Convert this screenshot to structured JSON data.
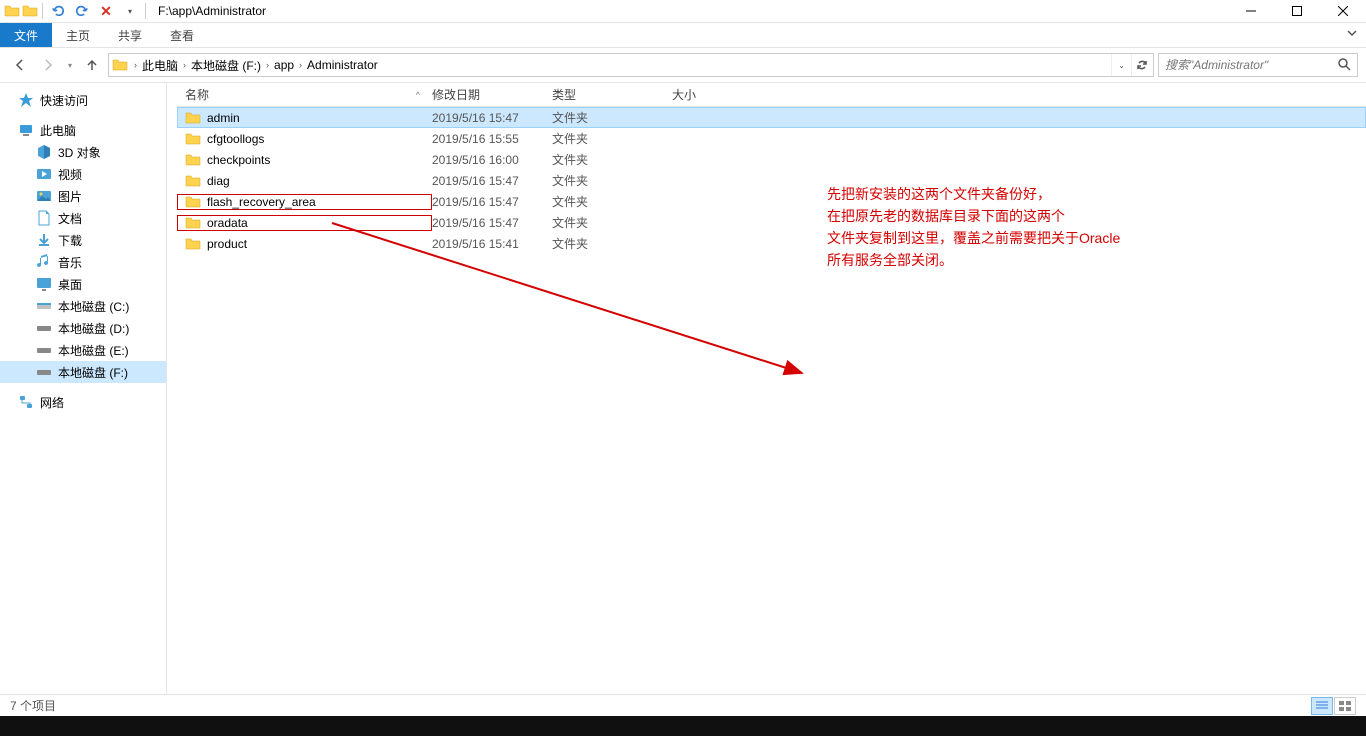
{
  "title_bar": {
    "path": "F:\\app\\Administrator"
  },
  "ribbon": {
    "tabs": {
      "file": "文件",
      "home": "主页",
      "share": "共享",
      "view": "查看"
    }
  },
  "breadcrumbs": {
    "pc": "此电脑",
    "drive": "本地磁盘 (F:)",
    "app": "app",
    "admin": "Administrator"
  },
  "search": {
    "placeholder": "搜索\"Administrator\""
  },
  "sidebar": {
    "quick_access": "快速访问",
    "this_pc": "此电脑",
    "children": {
      "objects3d": "3D 对象",
      "videos": "视频",
      "pictures": "图片",
      "documents": "文档",
      "downloads": "下载",
      "music": "音乐",
      "desktop": "桌面",
      "disk_c": "本地磁盘 (C:)",
      "disk_d": "本地磁盘 (D:)",
      "disk_e": "本地磁盘 (E:)",
      "disk_f": "本地磁盘 (F:)"
    },
    "network": "网络"
  },
  "columns": {
    "name": "名称",
    "date": "修改日期",
    "type": "类型",
    "size": "大小"
  },
  "type_folder": "文件夹",
  "files": [
    {
      "name": "admin",
      "date": "2019/5/16 15:47",
      "selected": true,
      "boxed": false
    },
    {
      "name": "cfgtoollogs",
      "date": "2019/5/16 15:55",
      "selected": false,
      "boxed": false
    },
    {
      "name": "checkpoints",
      "date": "2019/5/16 16:00",
      "selected": false,
      "boxed": false
    },
    {
      "name": "diag",
      "date": "2019/5/16 15:47",
      "selected": false,
      "boxed": false
    },
    {
      "name": "flash_recovery_area",
      "date": "2019/5/16 15:47",
      "selected": false,
      "boxed": true
    },
    {
      "name": "oradata",
      "date": "2019/5/16 15:47",
      "selected": false,
      "boxed": true
    },
    {
      "name": "product",
      "date": "2019/5/16 15:41",
      "selected": false,
      "boxed": false
    }
  ],
  "annotation": {
    "l1": "先把新安装的这两个文件夹备份好，",
    "l2": "在把原先老的数据库目录下面的这两个",
    "l3": "文件夹复制到这里，覆盖之前需要把关于Oracle",
    "l4": "所有服务全部关闭。"
  },
  "status": {
    "count": "7 个项目"
  }
}
